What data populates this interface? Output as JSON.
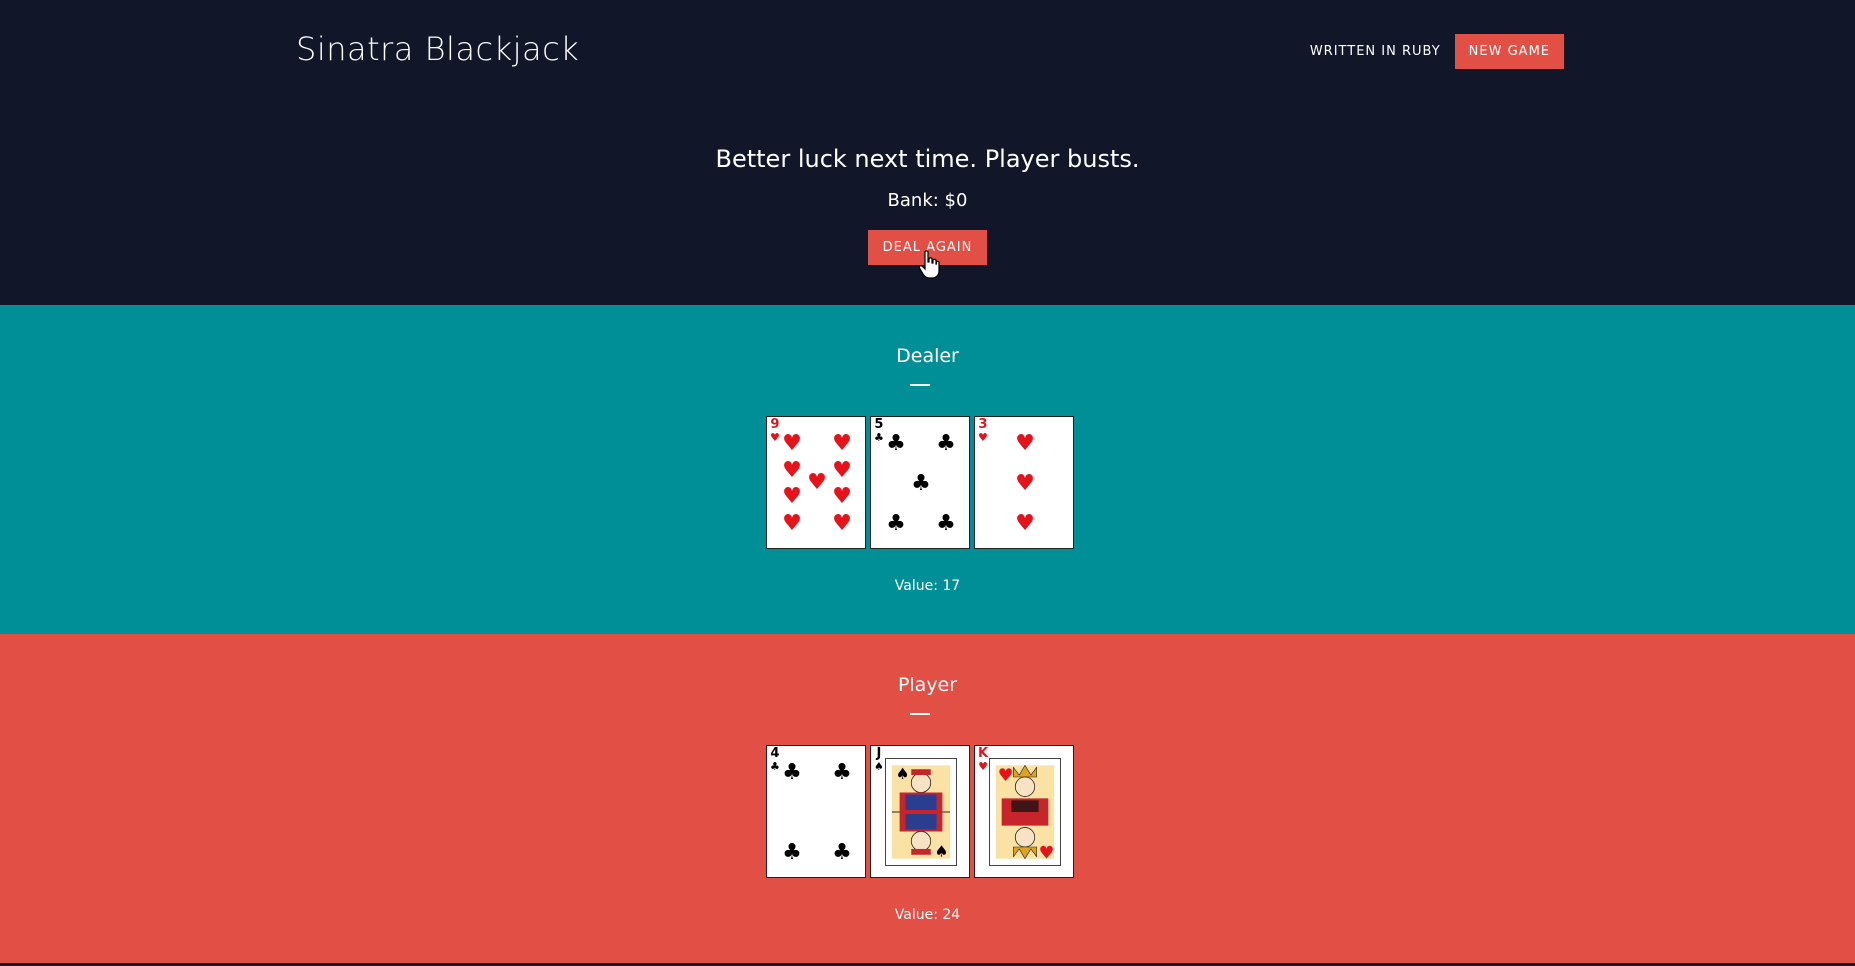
{
  "header": {
    "brand": "Sinatra Blackjack",
    "nav_link": "WRITTEN IN RUBY",
    "new_game": "NEW GAME"
  },
  "status": {
    "message": "Better luck next time. Player busts.",
    "bank": "Bank: $0",
    "deal_again": "DEAL AGAIN"
  },
  "dealer": {
    "title": "Dealer",
    "value": "Value: 17",
    "cards": [
      {
        "rank": "9",
        "suit": "♥",
        "color": "red"
      },
      {
        "rank": "5",
        "suit": "♣",
        "color": "black"
      },
      {
        "rank": "3",
        "suit": "♥",
        "color": "red"
      }
    ]
  },
  "player": {
    "title": "Player",
    "value": "Value: 24",
    "cards": [
      {
        "rank": "4",
        "suit": "♣",
        "color": "black"
      },
      {
        "rank": "J",
        "suit": "♠",
        "color": "black"
      },
      {
        "rank": "K",
        "suit": "♥",
        "color": "red"
      }
    ]
  },
  "colors": {
    "navy": "#111729",
    "teal": "#008f96",
    "coral": "#e24f45",
    "card_red": "#e8131a"
  }
}
